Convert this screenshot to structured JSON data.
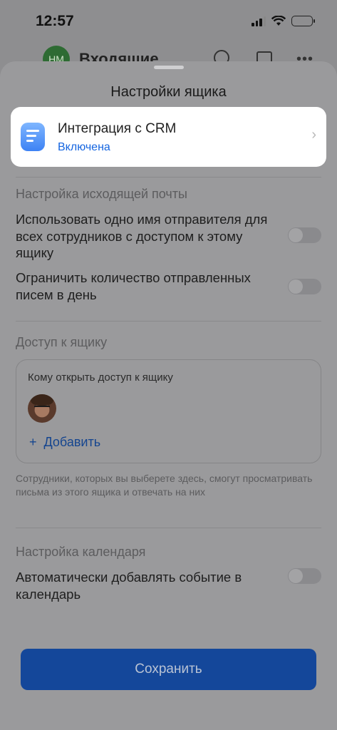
{
  "status_bar": {
    "time": "12:57"
  },
  "background_app": {
    "avatar_initials": "НМ",
    "title": "Входящие",
    "back_icon": "arrow-left-icon",
    "more_icon": "more-dots-icon"
  },
  "sheet": {
    "title": "Настройки ящика",
    "crm": {
      "title": "Интеграция с CRM",
      "status": "Включена",
      "status_color": "#1565e0"
    },
    "outgoing": {
      "section_title": "Настройка исходящей почты",
      "same_sender": {
        "label": "Использовать одно имя отправителя для всех сотрудников с доступом к этому ящику",
        "enabled": false
      },
      "limit_daily": {
        "label": "Ограничить количество отправленных писем в день",
        "enabled": false
      }
    },
    "access": {
      "section_title": "Доступ к ящику",
      "box_label": "Кому открыть доступ к ящику",
      "add_label": "Добавить",
      "hint": "Сотрудники, которых вы выберете здесь, смогут просматривать письма из этого ящика и отвечать на них"
    },
    "calendar": {
      "section_title": "Настройка календаря",
      "auto_event": {
        "label": "Автоматически добавлять событие в календарь",
        "enabled": false
      }
    },
    "save_label": "Сохранить",
    "accent_color": "#14479a"
  }
}
